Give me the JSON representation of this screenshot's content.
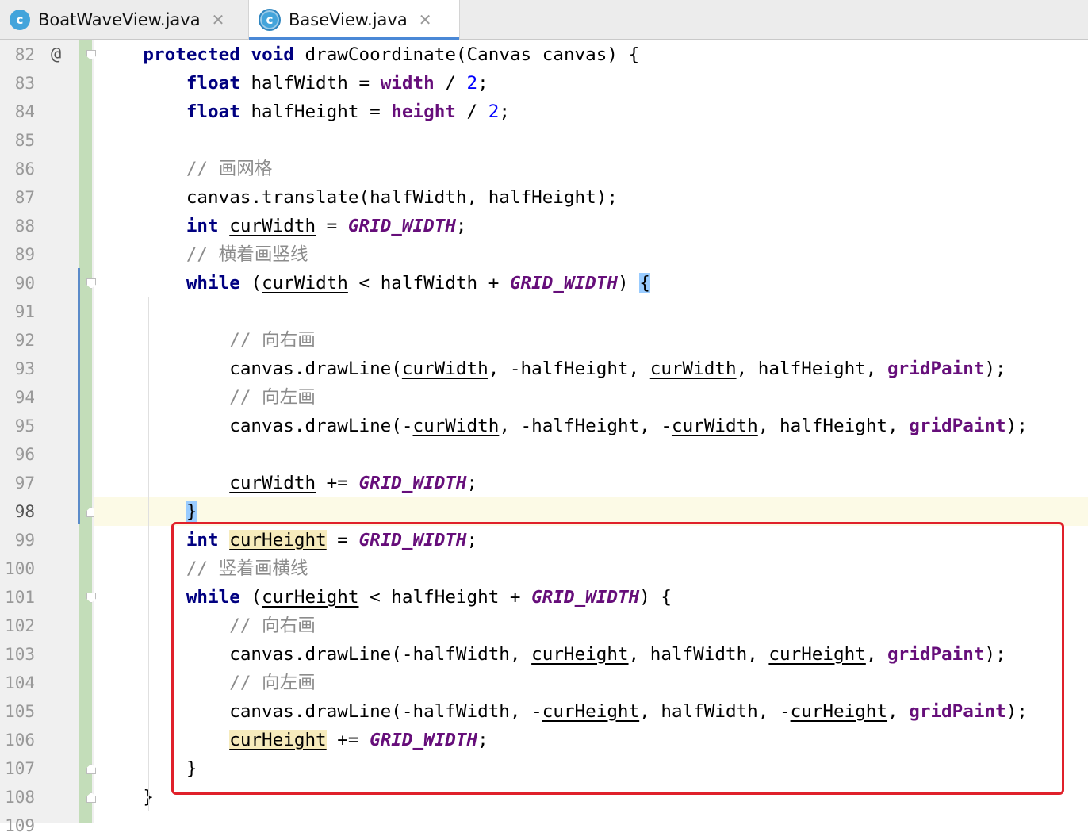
{
  "tabs": [
    {
      "label": "BoatWaveView.java",
      "icon": "c",
      "close": "✕",
      "active": false
    },
    {
      "label": "BaseView.java",
      "icon": "c",
      "close": "✕",
      "active": true
    }
  ],
  "gutter": {
    "annotation_symbol": "@",
    "line_numbers": [
      "82",
      "83",
      "84",
      "85",
      "86",
      "87",
      "88",
      "89",
      "90",
      "91",
      "92",
      "93",
      "94",
      "95",
      "96",
      "97",
      "98",
      "99",
      "100",
      "101",
      "102",
      "103",
      "104",
      "105",
      "106",
      "107",
      "108",
      "109"
    ],
    "current_line": "98"
  },
  "code_lines": [
    [
      [
        "    ",
        ""
      ],
      [
        "protected",
        "kw"
      ],
      [
        " ",
        ""
      ],
      [
        "void",
        "kw"
      ],
      [
        " drawCoordinate(Canvas canvas) {",
        ""
      ]
    ],
    [
      [
        "        ",
        ""
      ],
      [
        "float",
        "kw"
      ],
      [
        " halfWidth = ",
        ""
      ],
      [
        "width",
        "fld"
      ],
      [
        " / ",
        ""
      ],
      [
        "2",
        "num"
      ],
      [
        ";",
        ""
      ]
    ],
    [
      [
        "        ",
        ""
      ],
      [
        "float",
        "kw"
      ],
      [
        " halfHeight = ",
        ""
      ],
      [
        "height",
        "fld"
      ],
      [
        " / ",
        ""
      ],
      [
        "2",
        "num"
      ],
      [
        ";",
        ""
      ]
    ],
    [
      [
        "",
        ""
      ]
    ],
    [
      [
        "        ",
        ""
      ],
      [
        "// 画网格",
        "cmt"
      ]
    ],
    [
      [
        "        canvas.translate(halfWidth, halfHeight);",
        ""
      ]
    ],
    [
      [
        "        ",
        ""
      ],
      [
        "int",
        "kw"
      ],
      [
        " ",
        ""
      ],
      [
        "curWidth",
        "var"
      ],
      [
        " = ",
        ""
      ],
      [
        "GRID_WIDTH",
        "cst"
      ],
      [
        ";",
        ""
      ]
    ],
    [
      [
        "        ",
        ""
      ],
      [
        "// 横着画竖线",
        "cmt"
      ]
    ],
    [
      [
        "        ",
        ""
      ],
      [
        "while",
        "kw"
      ],
      [
        " (",
        ""
      ],
      [
        "curWidth",
        "var"
      ],
      [
        " < halfWidth + ",
        ""
      ],
      [
        "GRID_WIDTH",
        "cst"
      ],
      [
        ") ",
        ""
      ],
      [
        "{",
        "brace"
      ]
    ],
    [
      [
        "",
        ""
      ]
    ],
    [
      [
        "            ",
        ""
      ],
      [
        "// 向右画",
        "cmt"
      ]
    ],
    [
      [
        "            canvas.drawLine(",
        ""
      ],
      [
        "curWidth",
        "var"
      ],
      [
        ", -halfHeight, ",
        ""
      ],
      [
        "curWidth",
        "var"
      ],
      [
        ", halfHeight, ",
        ""
      ],
      [
        "gridPaint",
        "fld"
      ],
      [
        ");",
        ""
      ]
    ],
    [
      [
        "            ",
        ""
      ],
      [
        "// 向左画",
        "cmt"
      ]
    ],
    [
      [
        "            canvas.drawLine(-",
        ""
      ],
      [
        "curWidth",
        "var"
      ],
      [
        ", -halfHeight, -",
        ""
      ],
      [
        "curWidth",
        "var"
      ],
      [
        ", halfHeight, ",
        ""
      ],
      [
        "gridPaint",
        "fld"
      ],
      [
        ");",
        ""
      ]
    ],
    [
      [
        "",
        ""
      ]
    ],
    [
      [
        "            ",
        ""
      ],
      [
        "curWidth",
        "var"
      ],
      [
        " += ",
        ""
      ],
      [
        "GRID_WIDTH",
        "cst"
      ],
      [
        ";",
        ""
      ]
    ],
    [
      [
        "        ",
        ""
      ],
      [
        "}",
        "brace"
      ]
    ],
    [
      [
        "        ",
        ""
      ],
      [
        "int",
        "kw"
      ],
      [
        " ",
        ""
      ],
      [
        "curHeight",
        "var hl"
      ],
      [
        " = ",
        ""
      ],
      [
        "GRID_WIDTH",
        "cst"
      ],
      [
        ";",
        ""
      ]
    ],
    [
      [
        "        ",
        ""
      ],
      [
        "// 竖着画横线",
        "cmt"
      ]
    ],
    [
      [
        "        ",
        ""
      ],
      [
        "while",
        "kw"
      ],
      [
        " (",
        ""
      ],
      [
        "curHeight",
        "var"
      ],
      [
        " < halfHeight + ",
        ""
      ],
      [
        "GRID_WIDTH",
        "cst"
      ],
      [
        ") {",
        ""
      ]
    ],
    [
      [
        "            ",
        ""
      ],
      [
        "// 向右画",
        "cmt"
      ]
    ],
    [
      [
        "            canvas.drawLine(-halfWidth, ",
        ""
      ],
      [
        "curHeight",
        "var"
      ],
      [
        ", halfWidth, ",
        ""
      ],
      [
        "curHeight",
        "var"
      ],
      [
        ", ",
        ""
      ],
      [
        "gridPaint",
        "fld"
      ],
      [
        ");",
        ""
      ]
    ],
    [
      [
        "            ",
        ""
      ],
      [
        "// 向左画",
        "cmt"
      ]
    ],
    [
      [
        "            canvas.drawLine(-halfWidth, -",
        ""
      ],
      [
        "curHeight",
        "var"
      ],
      [
        ", halfWidth, -",
        ""
      ],
      [
        "curHeight",
        "var"
      ],
      [
        ", ",
        ""
      ],
      [
        "gridPaint",
        "fld"
      ],
      [
        ");",
        ""
      ]
    ],
    [
      [
        "            ",
        ""
      ],
      [
        "curHeight",
        "var hl"
      ],
      [
        " += ",
        ""
      ],
      [
        "GRID_WIDTH",
        "cst"
      ],
      [
        ";",
        ""
      ]
    ],
    [
      [
        "        }",
        ""
      ]
    ],
    [
      [
        "    }",
        ""
      ]
    ],
    [
      [
        "",
        ""
      ]
    ]
  ],
  "colors": {
    "keyword": "#000080",
    "field": "#660e7a",
    "number": "#0000ff",
    "comment": "#8c8c8c",
    "selection_box": "#e0202a",
    "tab_accent": "#4a88d6"
  }
}
